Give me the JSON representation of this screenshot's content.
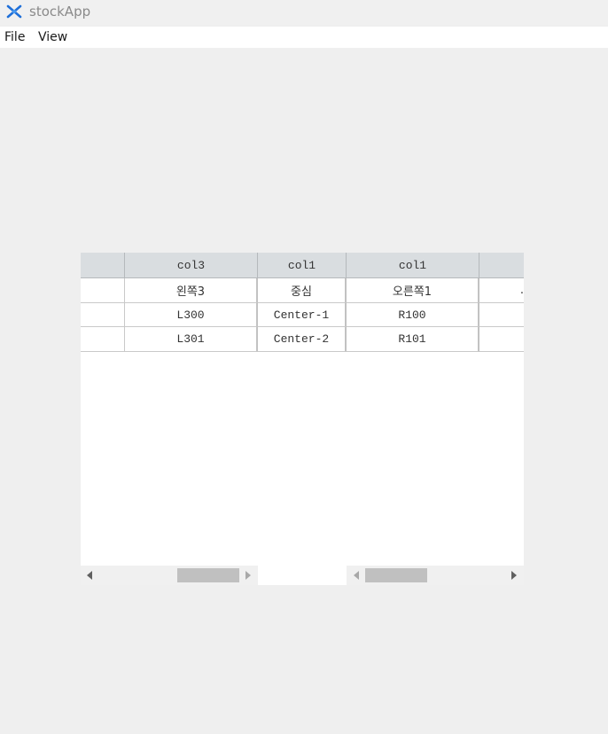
{
  "window": {
    "title": "stockApp",
    "icon": "app-logo-icon"
  },
  "menu": {
    "items": [
      {
        "label": "File"
      },
      {
        "label": "View"
      }
    ]
  },
  "table": {
    "left_headers": [
      "",
      "col3"
    ],
    "center_headers": [
      "col1"
    ],
    "right_headers": [
      "col1",
      ""
    ],
    "rows": [
      {
        "left": [
          "",
          "왼쪽3"
        ],
        "center": [
          "중심"
        ],
        "right": [
          "오른쪽1",
          "."
        ]
      },
      {
        "left": [
          "",
          "L300"
        ],
        "center": [
          "Center-1"
        ],
        "right": [
          "R100",
          ""
        ]
      },
      {
        "left": [
          "",
          "L301"
        ],
        "center": [
          "Center-2"
        ],
        "right": [
          "R101",
          ""
        ]
      }
    ]
  },
  "colors": {
    "header_bg": "#d9dde0",
    "accent": "#1e6fd9"
  }
}
